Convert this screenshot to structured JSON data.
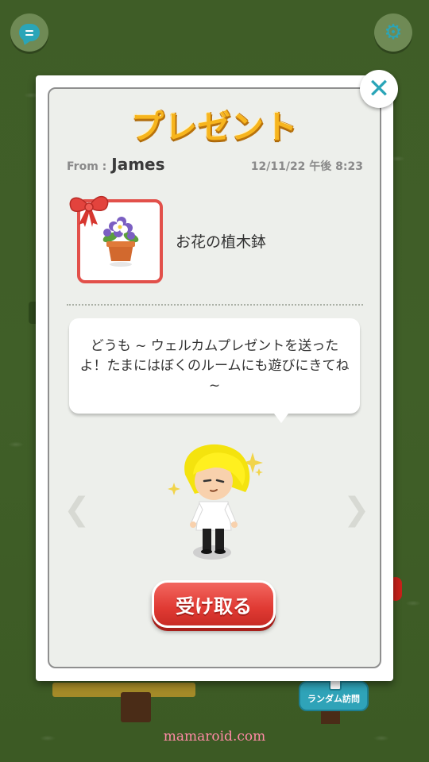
{
  "top_bar": {
    "chat_icon": "chat-bubble-icon",
    "settings_icon": "gear-icon"
  },
  "background": {
    "random_visit_label": "ランダム訪問",
    "watermark": "mamaroid.com"
  },
  "dialog": {
    "title": "プレゼント",
    "close_icon": "close-icon",
    "from_label": "From :",
    "from_name": "James",
    "timestamp": "12/11/22 午後 8:23",
    "item": {
      "icon": "flower-pot-icon",
      "name": "お花の植木鉢"
    },
    "message": "どうも ~ ウェルカムプレゼントを送ったよ！たまにはぼくのルームにも遊びにきてね ~",
    "nav": {
      "prev_icon": "chevron-left-icon",
      "next_icon": "chevron-right-icon"
    },
    "receive_button_label": "受け取る"
  },
  "colors": {
    "accent_teal": "#2aa5b8",
    "title_gold": "#f7b51d",
    "button_red": "#e03a33",
    "grass": "#3f5d27"
  }
}
